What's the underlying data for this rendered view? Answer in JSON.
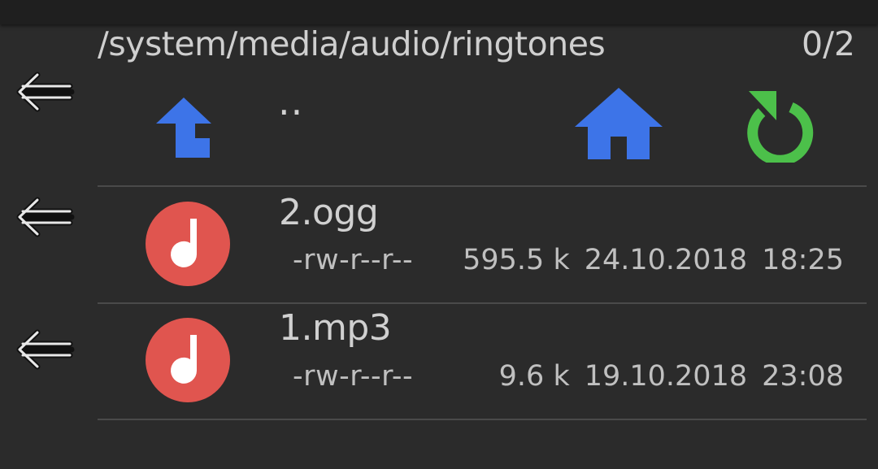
{
  "header": {
    "path": "/system/media/audio/ringtones",
    "count": "0/2"
  },
  "parent_row": {
    "label": ".."
  },
  "files": [
    {
      "name": "2.ogg",
      "permissions": "-rw-r--r--",
      "size": "595.5 k",
      "date": "24.10.2018",
      "time": "18:25",
      "icon": "music-note-icon"
    },
    {
      "name": "1.mp3",
      "permissions": "-rw-r--r--",
      "size": "9.6 k",
      "date": "19.10.2018",
      "time": "23:08",
      "icon": "music-note-icon"
    }
  ],
  "icons": {
    "back": "back-arrow-icon",
    "up": "folder-up-icon",
    "home": "home-icon",
    "refresh": "refresh-icon"
  },
  "colors": {
    "background": "#2b2b2b",
    "accent_blue": "#3d74e8",
    "accent_green": "#4cc04a",
    "file_red": "#e0554f"
  }
}
